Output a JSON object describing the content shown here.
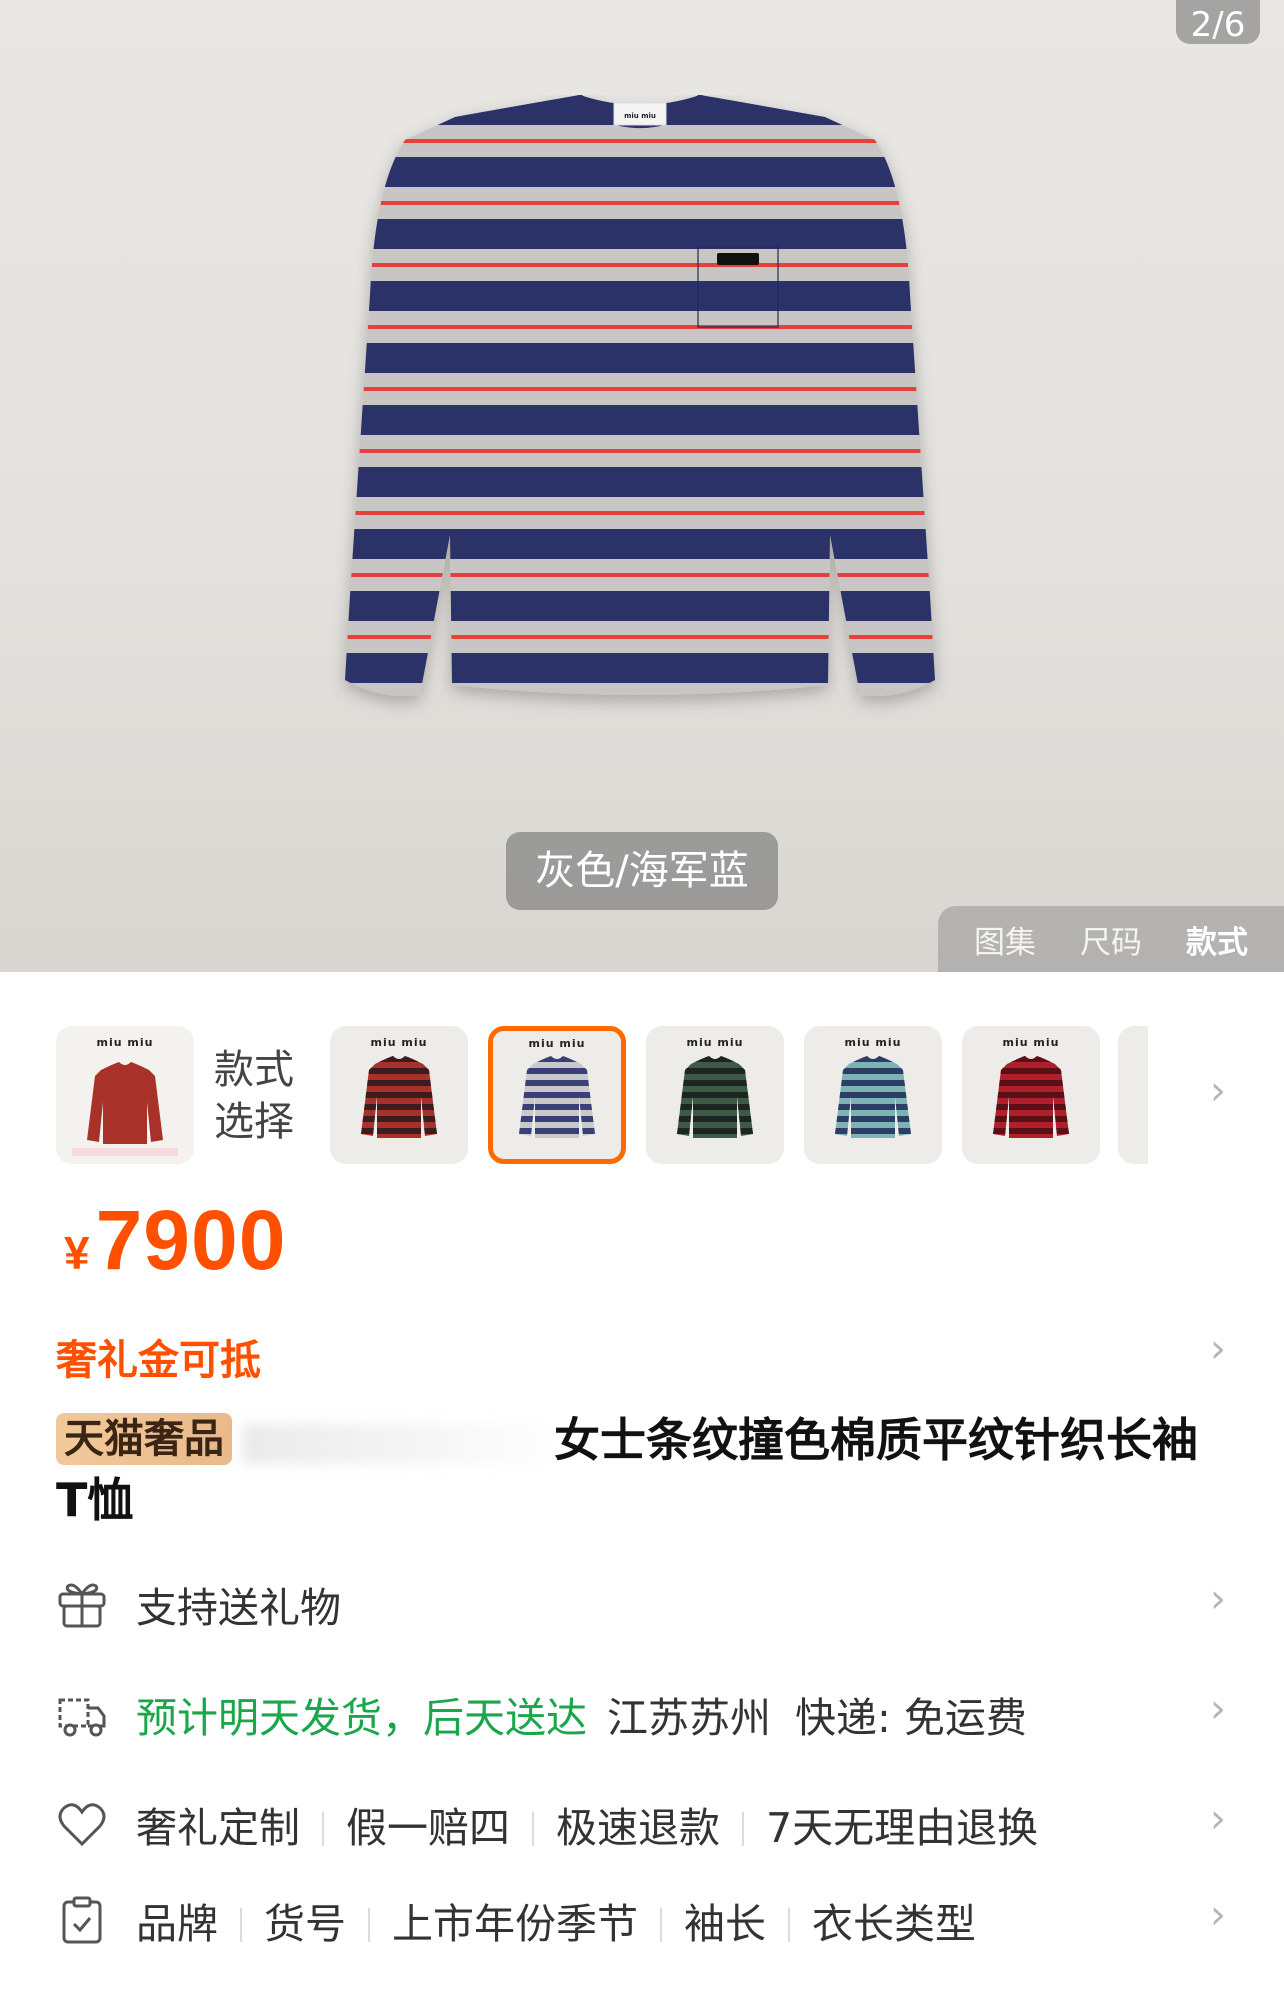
{
  "hero": {
    "image_counter": "2/6",
    "color_label": "灰色/海军蓝",
    "view_tabs": [
      "图集",
      "尺码",
      "款式"
    ],
    "active_view_tab": "款式",
    "shirt_colors": {
      "navy": "#2c3168",
      "grey": "#c7c6c4",
      "red": "#e5403a"
    },
    "collar_label": "miu miu"
  },
  "style_selector": {
    "label": "款式\n选择",
    "thumb_brand": "miu miu",
    "variants": [
      {
        "name": "red-black",
        "body": "#a8322a",
        "stripe": "#3a1d1c",
        "selected": false
      },
      {
        "name": "grey-navy",
        "body": "#c9c8cb",
        "stripe": "#3a3f79",
        "selected": true
      },
      {
        "name": "green-black",
        "body": "#3c5a45",
        "stripe": "#1d2520",
        "selected": false
      },
      {
        "name": "teal-navy",
        "body": "#7ab4b3",
        "stripe": "#2c3e66",
        "selected": false
      },
      {
        "name": "red-dark",
        "body": "#b0202a",
        "stripe": "#5a1017",
        "selected": false
      }
    ],
    "arrow": "›"
  },
  "price": {
    "currency": "¥",
    "value": "7900"
  },
  "promo": {
    "text": "奢礼金可抵",
    "arrow": "›"
  },
  "title": {
    "badge": "天猫奢品",
    "text": "女士条纹撞色棉质平纹针织长袖T恤"
  },
  "info": {
    "gift": {
      "text": "支持送礼物"
    },
    "shipping": {
      "eta": "预计明天发货，后天送达",
      "origin": "江苏苏州",
      "express": "快递: 免运费"
    },
    "services": [
      "奢礼定制",
      "假一赔四",
      "极速退款",
      "7天无理由退换"
    ],
    "params": [
      "品牌",
      "货号",
      "上市年份季节",
      "袖长",
      "衣长类型"
    ]
  },
  "colors": {
    "accent": "#ff5000",
    "green": "#1aa64a",
    "selected_border": "#ff6a00"
  }
}
